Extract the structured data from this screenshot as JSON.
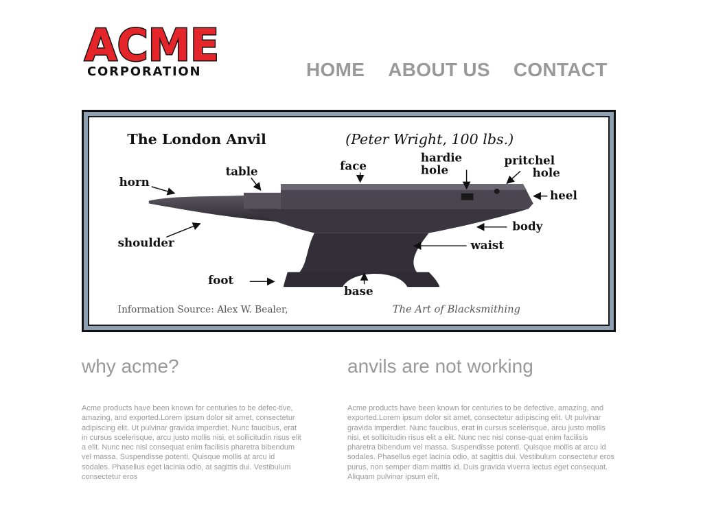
{
  "logo": {
    "wordmark": "ACME",
    "subtitle": "CORPORATION",
    "colors": {
      "fill": "#e4262b",
      "outline": "#111111"
    }
  },
  "nav": {
    "items": [
      {
        "label": "HOME"
      },
      {
        "label": "ABOUT US"
      },
      {
        "label": "CONTACT"
      }
    ]
  },
  "hero": {
    "title": "The London Anvil",
    "subtitle": "(Peter Wright, 100 lbs.)",
    "labels": {
      "horn": "horn",
      "table": "table",
      "face": "face",
      "hardie_1": "hardie",
      "hardie_2": "hole",
      "pritchel_1": "pritchel",
      "pritchel_2": "hole",
      "heel": "heel",
      "body": "body",
      "waist": "waist",
      "shoulder": "shoulder",
      "foot": "foot",
      "base": "base"
    },
    "source_prefix": "Information Source: Alex W. Bealer,",
    "source_title": "The Art of Blacksmithing"
  },
  "sections": [
    {
      "heading": "why acme?",
      "body": "Acme products have been known for centuries to be defec-tive, amazing, and exported.Lorem ipsum dolor sit amet, consectetur adipiscing elit. Ut pulvinar gravida imperdiet. Nunc faucibus, erat in cursus scelerisque, arcu justo mollis nisi, et sollicitudin risus elit a elit. Nunc nec nisl consequat enim facilisis pharetra bibendum vel massa. Suspendisse potenti. Quisque mollis at arcu id sodales. Phasellus eget lacinia odio, at sagittis dui. Vestibulum consectetur eros"
    },
    {
      "heading": "anvils are not working",
      "body": "Acme products have been known for centuries to be defective, amazing, and exported.Lorem ipsum dolor sit amet, consectetur adipiscing elit. Ut pulvinar gravida imperdiet. Nunc faucibus, erat in cursus scelerisque, arcu justo mollis nisi, et sollicitudin risus elit a elit. Nunc nec nisl conse-quat enim facilisis pharetra bibendum vel massa. Suspendisse potenti. Quisque mollis at arcu id sodales. Phasellus eget lacinia odio, at sagittis dui. Vestibulum consectetur eros purus, non semper diam mattis id. Duis gravida viverra lectus eget consequat. Aliquam pulvinar ipsum elit,"
    }
  ]
}
